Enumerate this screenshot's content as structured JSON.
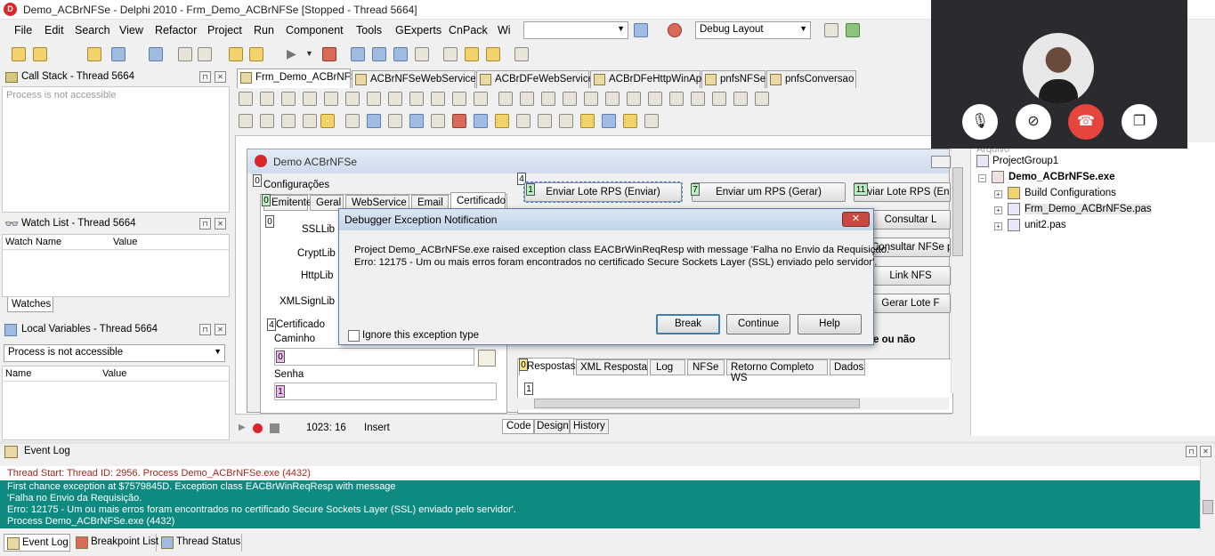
{
  "window": {
    "title": "Demo_ACBrNFSe - Delphi 2010 - Frm_Demo_ACBrNFSe [Stopped - Thread 5664]"
  },
  "menu": [
    "File",
    "Edit",
    "Search",
    "View",
    "Refactor",
    "Project",
    "Run",
    "Component",
    "Tools",
    "GExperts",
    "CnPack",
    "Wi"
  ],
  "toolbar": {
    "combo_empty_value": "",
    "layout_combo": "Debug Layout"
  },
  "call_stack": {
    "title": "Call Stack - Thread 5664",
    "message": "Process is not accessible"
  },
  "watch_list": {
    "title": "Watch List - Thread 5664",
    "columns": [
      "Watch Name",
      "Value"
    ],
    "tab": "Watches"
  },
  "local_vars": {
    "title": "Local Variables - Thread 5664",
    "combo": "Process is not accessible",
    "columns": [
      "Name",
      "Value"
    ]
  },
  "editor_tabs": [
    "Frm_Demo_ACBrNFSe",
    "ACBrNFSeWebServices",
    "ACBrDFeWebService",
    "ACBrDFeHttpWinApi",
    "pnfsNFSe",
    "pnfsConversao"
  ],
  "designer": {
    "form_caption": "Demo ACBrNFSe",
    "group_config": "Configurações",
    "config_tabs": [
      "Emitente",
      "Geral",
      "WebService",
      "Email",
      "Certificado"
    ],
    "lib_labels": [
      "SSLLib",
      "CryptLib",
      "HttpLib",
      "XMLSignLib"
    ],
    "group_cert": "Certificado",
    "cert_path_label": "Caminho",
    "cert_pass_label": "Senha",
    "buttons": [
      "Enviar Lote RPS (Enviar)",
      "Enviar um RPS (Gerar)",
      "Enviar Lote RPS (En",
      "Consultar L",
      "Consultar NFSe po",
      "Link NFS",
      "Gerar Lote F"
    ],
    "bold_label": "e ou não",
    "result_tabs": [
      "Respostas",
      "XML Resposta",
      "Log",
      "NFSe",
      "Retorno Completo WS",
      "Dados"
    ],
    "markers": [
      "0",
      "0",
      "0",
      "7",
      "11",
      "1",
      "4",
      "0",
      "1",
      "4",
      "1",
      "0"
    ]
  },
  "status": {
    "position": "1023:  16",
    "mode": "Insert",
    "view_tabs": [
      "Code",
      "Design",
      "History"
    ]
  },
  "dialog": {
    "title": "Debugger Exception Notification",
    "close": "✕",
    "message_line1": "Project Demo_ACBrNFSe.exe raised exception class EACBrWinReqResp with message 'Falha no Envio da Requisição.",
    "message_line2": "Erro: 12175 - Um ou mais erros foram encontrados no certificado Secure Sockets Layer (SSL) enviado pelo servidor'.",
    "checkbox_label": "Ignore this exception type",
    "buttons": [
      "Break",
      "Continue",
      "Help"
    ]
  },
  "project_tree": {
    "header": "Arquivo",
    "items": [
      "ProjectGroup1",
      "Demo_ACBrNFSe.exe",
      "Build Configurations",
      "Frm_Demo_ACBrNFSe.pas",
      "unit2.pas"
    ]
  },
  "event_log": {
    "title": "Event Log",
    "lines": [
      "Thread Start: Thread ID: 2956. Process Demo_ACBrNFSe.exe (4432)",
      "First chance exception at $7579845D. Exception class EACBrWinReqResp with message",
      "'Falha no Envio da Requisição.",
      "Erro: 12175 - Um ou mais erros foram encontrados no certificado Secure Sockets Layer (SSL) enviado pelo servidor'.",
      "Process Demo_ACBrNFSe.exe (4432)"
    ],
    "highlight_color": "#0f8a80"
  },
  "bottom_tabs": [
    "Event Log",
    "Breakpoint List",
    "Thread Status"
  ]
}
